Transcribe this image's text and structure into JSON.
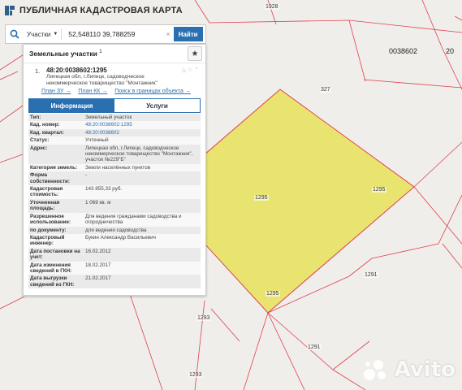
{
  "app": {
    "title": "ПУБЛИЧНАЯ КАДАСТРОВАЯ КАРТА"
  },
  "search": {
    "type_label": "Участки",
    "query": "52,548110 39,788259",
    "button_label": "Найти"
  },
  "panel": {
    "title": "Земельные участки",
    "count": "1",
    "item": {
      "index": "1.",
      "cad_number": "48:20:0038602:1295",
      "address": "Липецкая обл, г.Липецк, садоводческое некоммерческое товарищество \"Монтажник\"",
      "links": [
        "План ЗУ →",
        "План КК →",
        "Поиск в границах объекта →"
      ]
    },
    "tabs": [
      "Информация",
      "Услуги"
    ],
    "rows": [
      {
        "k": "Тип:",
        "v": "Земельный участок"
      },
      {
        "k": "Кад. номер:",
        "v": "48:20:0038602:1295"
      },
      {
        "k": "Кад. квартал:",
        "v": "48:20:0038602"
      },
      {
        "k": "Статус:",
        "v": "Учтенный"
      },
      {
        "k": "Адрес:",
        "v": "Липецкая обл, г.Липецк, садоводческое некоммерческое товарищество \"Монтажник\", участок №229\"Б\""
      },
      {
        "k": "Категория земель:",
        "v": "Земли населённых пунктов"
      },
      {
        "k": "Форма собственности:",
        "v": "-"
      },
      {
        "k": "Кадастровая стоимость:",
        "v": "143 855,33 руб."
      },
      {
        "k": "Уточненная площадь:",
        "v": "1 069 кв. м"
      },
      {
        "k": "Разрешенное использование:",
        "v": "Для ведения гражданами садоводства и огородничества"
      },
      {
        "k": "по документу:",
        "v": "для ведения садоводства"
      },
      {
        "k": "Кадастровый инженер:",
        "v": "Букин Александр Васильевич"
      },
      {
        "k": "Дата постановки на учет:",
        "v": "16.02.2012"
      },
      {
        "k": "Дата изменения сведений в ГКН:",
        "v": "18.02.2017"
      },
      {
        "k": "Дата выгрузки сведений из ГКН:",
        "v": "21.02.2017"
      }
    ]
  },
  "map": {
    "labels": [
      "1928",
      "0038602",
      "20",
      "327",
      "1295",
      "1295",
      "1295",
      "1291",
      "1291",
      "1293",
      "1293"
    ],
    "parcel_color": "#e8e46f",
    "border_color": "#e04050"
  },
  "watermark": {
    "text": "Avito"
  }
}
